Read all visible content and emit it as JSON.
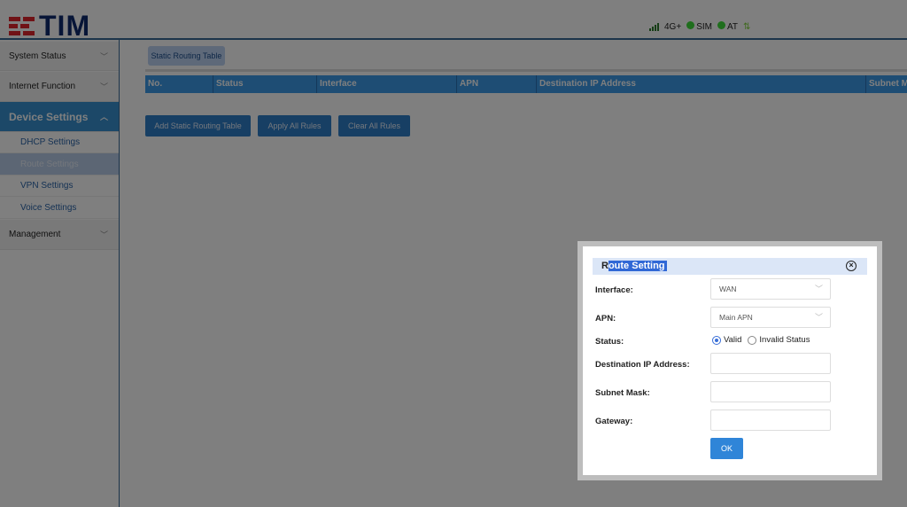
{
  "header": {
    "logo": "TIM",
    "network": "4G+",
    "sim": "SIM",
    "at": "AT"
  },
  "sidebar": {
    "items": [
      {
        "label": "System Status"
      },
      {
        "label": "Internet Function"
      },
      {
        "label": "Device Settings"
      },
      {
        "label": "Management"
      }
    ],
    "sub": [
      {
        "label": "DHCP Settings"
      },
      {
        "label": "Route Settings"
      },
      {
        "label": "VPN Settings"
      },
      {
        "label": "Voice Settings"
      }
    ]
  },
  "main": {
    "tab": "Static Routing Table",
    "columns": [
      "No.",
      "Status",
      "Interface",
      "APN",
      "Destination IP Address",
      "Subnet Ma"
    ],
    "buttons": {
      "add": "Add Static Routing Table",
      "apply": "Apply All Rules",
      "clear": "Clear All Rules"
    }
  },
  "dialog": {
    "title_first": "R",
    "title_rest": "oute Setting",
    "interface_label": "Interface:",
    "interface_value": "WAN",
    "apn_label": "APN:",
    "apn_value": "Main APN",
    "status_label": "Status:",
    "valid": "Valid",
    "invalid": "Invalid Status",
    "dest_label": "Destination IP Address:",
    "dest_value": "",
    "mask_label": "Subnet Mask:",
    "mask_value": "",
    "gateway_label": "Gateway:",
    "gateway_value": "",
    "ok": "OK"
  }
}
